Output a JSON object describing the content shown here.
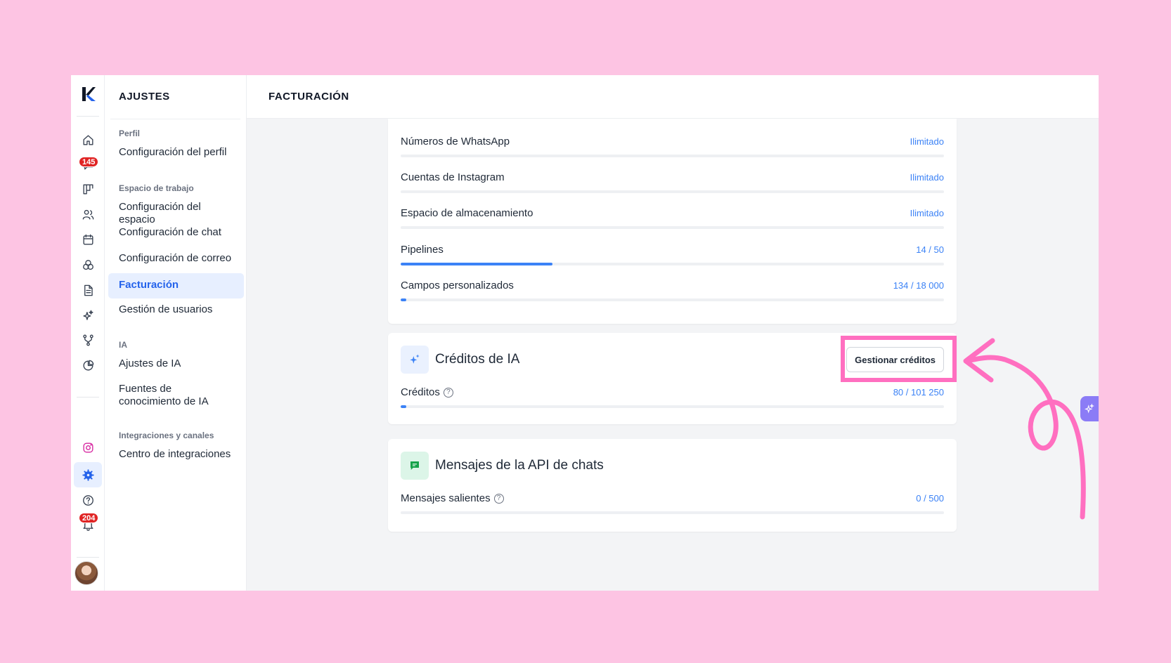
{
  "rail": {
    "items": [
      {
        "name": "home-icon"
      },
      {
        "name": "chat-icon",
        "badge": "145"
      },
      {
        "name": "board-icon"
      },
      {
        "name": "contacts-icon"
      },
      {
        "name": "calendar-icon"
      },
      {
        "name": "segments-icon"
      },
      {
        "name": "document-icon"
      },
      {
        "name": "sparkles-icon"
      },
      {
        "name": "automation-icon"
      },
      {
        "name": "analytics-icon"
      },
      {
        "name": "instagram-icon"
      },
      {
        "name": "settings-icon",
        "active": true
      },
      {
        "name": "help-icon"
      },
      {
        "name": "bell-icon",
        "badge": "204"
      }
    ]
  },
  "nav": {
    "title": "AJUSTES",
    "sections": [
      {
        "label": "Perfil",
        "items": [
          "Configuración del perfil"
        ]
      },
      {
        "label": "Espacio de trabajo",
        "items": [
          "Configuración del espacio",
          "Configuración de chat",
          "Configuración de correo",
          "Facturación",
          "Gestión de usuarios"
        ]
      },
      {
        "label": "IA",
        "items": [
          "Ajustes de IA",
          "Fuentes de conocimiento de IA"
        ]
      },
      {
        "label": "Integraciones y canales",
        "items": [
          "Centro de integraciones"
        ]
      }
    ],
    "active_item": "Facturación"
  },
  "main": {
    "title": "FACTURACIÓN",
    "limits": [
      {
        "label": "Números de WhatsApp",
        "value": "Ilimitado",
        "progress": null
      },
      {
        "label": "Cuentas de Instagram",
        "value": "Ilimitado",
        "progress": null
      },
      {
        "label": "Espacio de almacenamiento",
        "value": "Ilimitado",
        "progress": null
      },
      {
        "label": "Pipelines",
        "value": "14 / 50",
        "progress": 0.28
      },
      {
        "label": "Campos personalizados",
        "value": "134 / 18 000",
        "progress": 0.0074
      }
    ],
    "ai_credits": {
      "title": "Créditos de IA",
      "button": "Gestionar créditos",
      "row_label": "Créditos",
      "row_value": "80 / 101 250",
      "progress": 0.0008
    },
    "api_messages": {
      "title": "Mensajes de la API de chats",
      "row_label": "Mensajes salientes",
      "row_value": "0 / 500",
      "progress": 0
    }
  },
  "colors": {
    "accent": "#2563eb",
    "badge": "#e02424",
    "highlight": "#ff6fc0",
    "background": "#fdc4e3"
  }
}
